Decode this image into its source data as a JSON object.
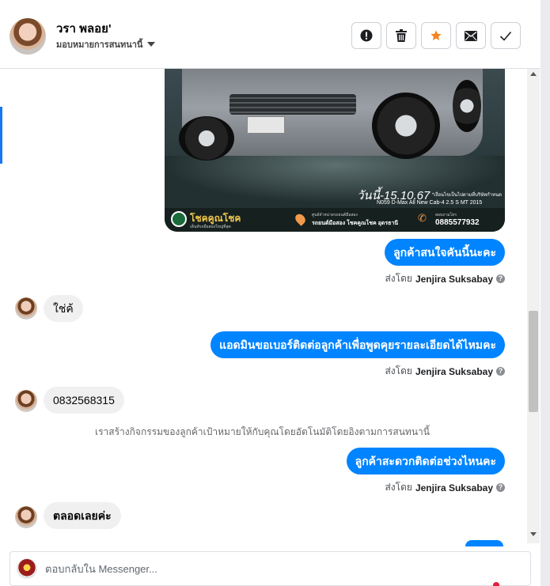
{
  "header": {
    "contact_name": "วรา พลอย'",
    "assign_label": "มอบหมายการสนทนานี้"
  },
  "toolbar": {
    "icons": [
      "alert-icon",
      "trash-icon",
      "star-icon",
      "mail-icon",
      "check-icon"
    ],
    "star_color": "#f5821f"
  },
  "car_ad": {
    "date_text": "วันนี้-15.10.67",
    "note_text": "*เงื่อนไขเป็นไปตามที่บริษัทกำหนด",
    "model_text": "N059  D-Max All New Cab-4 2.5 S MT 2015",
    "brand_name": "โชคคูณโชค",
    "brand_tagline": "เต็นท์รถมือสองใหญ่ที่สุด",
    "location_label": "ศูนย์จำหน่ายรถยนต์มือสอง",
    "location_name": "รถยนต์มือสอง โชคคูณโชค อุดรธานี",
    "phone_label": "สอบถามโทร",
    "phone": "0885577932"
  },
  "messages": [
    {
      "direction": "out",
      "text": "ลูกค้าสนใจคันนี้นะคะ"
    },
    {
      "direction": "in",
      "text": "ใช่ค้"
    },
    {
      "direction": "out",
      "text": "แอดมินขอเบอร์ติดต่อลูกค้าเพื่อพูดคุยรายละเอียดได้ไหมคะ"
    },
    {
      "direction": "in",
      "text": "0832568315"
    },
    {
      "direction": "out",
      "text": "ลูกค้าสะดวกติดต่อช่วงไหนคะ"
    },
    {
      "direction": "in",
      "text": "ตลอดเลยค่ะ"
    }
  ],
  "sent_by": {
    "prefix": "ส่งโดย",
    "agent": "Jenjira Suksabay",
    "info_glyph": "?"
  },
  "system_note": "เราสร้างกิจกรรมของลูกค้าเป้าหมายให้กับคุณโดยอัตโนมัติโดยอิงตามการสนทนานี้",
  "composer": {
    "placeholder": "ตอบกลับใน Messenger..."
  },
  "colors": {
    "outgoing_bubble": "#0084ff",
    "incoming_bubble": "#f0f0f0",
    "accent": "#1877f2"
  }
}
